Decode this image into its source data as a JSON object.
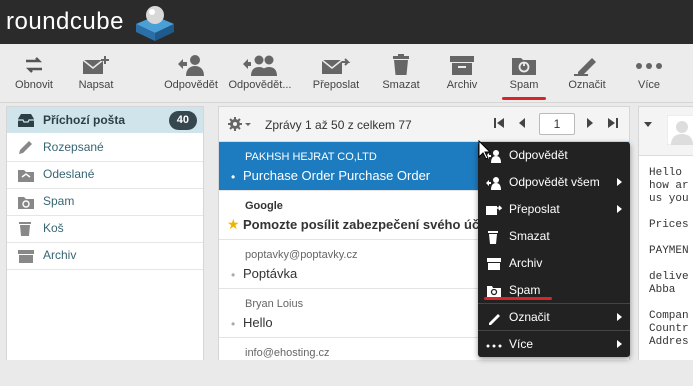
{
  "app": {
    "logo_text": "roundcube"
  },
  "toolbar": {
    "refresh": "Obnovit",
    "compose": "Napsat",
    "reply": "Odpovědět",
    "reply_all": "Odpovědět...",
    "forward": "Přeposlat",
    "delete": "Smazat",
    "archive": "Archiv",
    "spam": "Spam",
    "mark": "Označit",
    "more": "Více"
  },
  "folders": [
    {
      "name": "Příchozí pošta",
      "count": "40"
    },
    {
      "name": "Rozepsané"
    },
    {
      "name": "Odeslané"
    },
    {
      "name": "Spam"
    },
    {
      "name": "Koš"
    },
    {
      "name": "Archiv"
    }
  ],
  "list": {
    "info": "Zprávy 1 až 50 z celkem 77",
    "page": "1",
    "messages": [
      {
        "from": "PAKHSH HEJRAT CO,LTD",
        "subject": "Purchase Order Purchase Order"
      },
      {
        "from": "Google",
        "subject": "Pomozte posílit zabezpečení svého úč"
      },
      {
        "from": "poptavky@poptavky.cz",
        "subject": "Poptávka"
      },
      {
        "from": "Bryan Loius",
        "subject": "Hello"
      },
      {
        "from": "info@ehosting.cz",
        "subject": ""
      }
    ]
  },
  "preview": {
    "text": "Hello\nhow ar\nus you\n\nPrices\n\nPAYMEN\n\ndelive\nAbba\n\nCompan\nCountr\nAddres"
  },
  "context_menu": {
    "items": [
      "Odpovědět",
      "Odpovědět všem",
      "Přeposlat",
      "Smazat",
      "Archiv",
      "Spam",
      "Označit",
      "Více"
    ]
  },
  "colors": {
    "topbar": "#2b2b2b",
    "selection": "#1d7bbf",
    "highlight": "#d9252a",
    "folder_selected": "#d0e4ec",
    "menu_bg": "#222222"
  }
}
